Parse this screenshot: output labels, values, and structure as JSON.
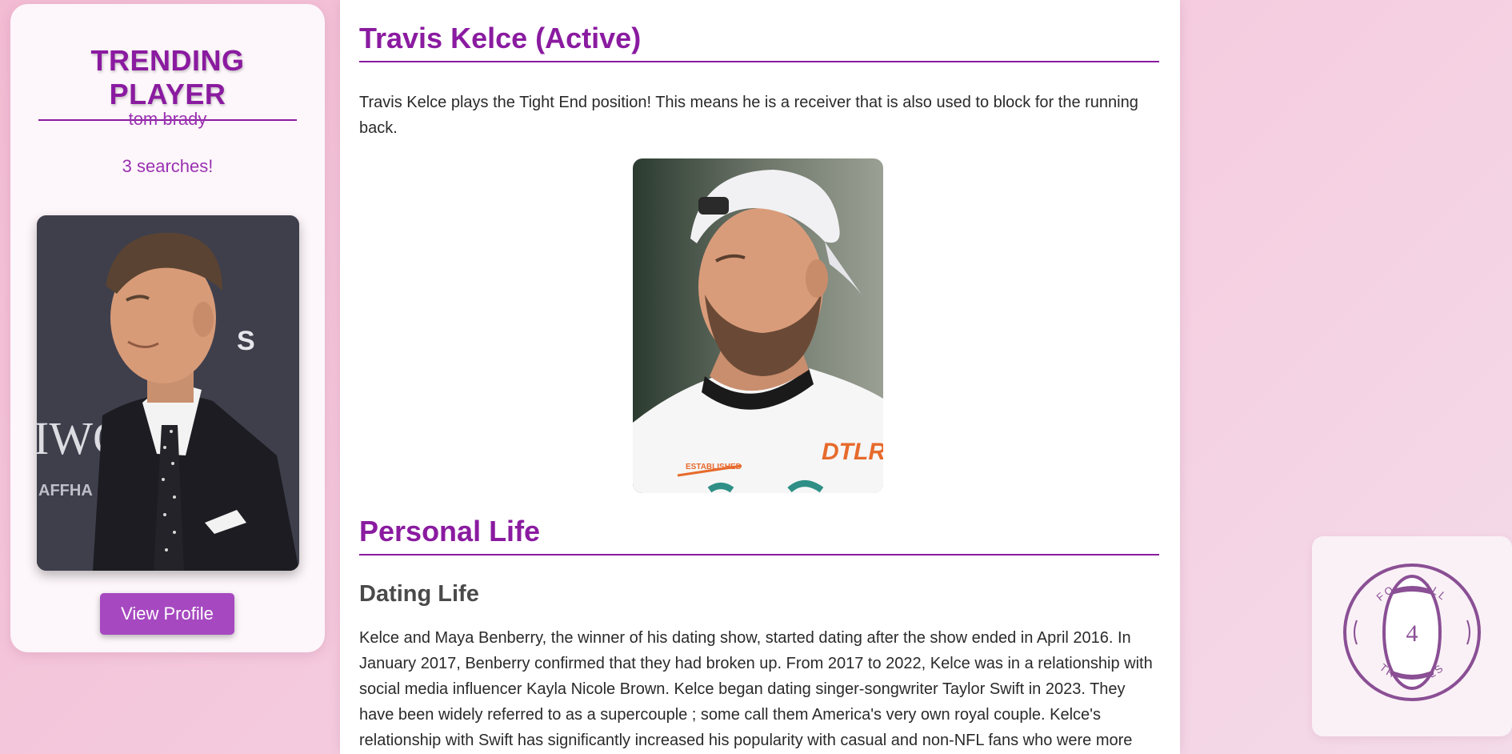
{
  "trending": {
    "title": "TRENDING PLAYER",
    "player_name": "tom brady",
    "searches": "3 searches!",
    "button_label": "View Profile"
  },
  "player": {
    "title": "Travis Kelce (Active)",
    "intro": "Travis Kelce plays the Tight End position! This means he is a receiver that is also used to block for the running back."
  },
  "personal_life": {
    "title": "Personal Life",
    "dating": {
      "title": "Dating Life",
      "text": "Kelce and Maya Benberry, the winner of his dating show, started dating after the show ended in April 2016. In January 2017, Benberry confirmed that they had broken up. From 2017 to 2022, Kelce was in a relationship with social media influencer Kayla Nicole Brown. Kelce began dating singer-songwriter Taylor Swift in 2023. They have been widely referred to as a supercouple ; some call them America's very own royal couple. Kelce's relationship with Swift has significantly increased his popularity with casual and non-NFL fans who were more familiar with Swift, such as resulting in him receiving the most fan votes for the 2025 Pro Bowl Games. Their"
    }
  },
  "photos": {
    "trending_text": "IWC",
    "trending_text_small": "AFFHA",
    "trending_text_right": "S",
    "kelce_jersey": "DTLR",
    "kelce_jersey_small": "ESTABLISHED"
  },
  "logo": {
    "top_text": "FOOTBALL",
    "number": "4",
    "bottom_text": "THE GIRLS"
  },
  "colors": {
    "accent": "#8a1ba0",
    "button": "#a648c0",
    "logo": "#8a4f94",
    "background": "#f4c9dd"
  }
}
